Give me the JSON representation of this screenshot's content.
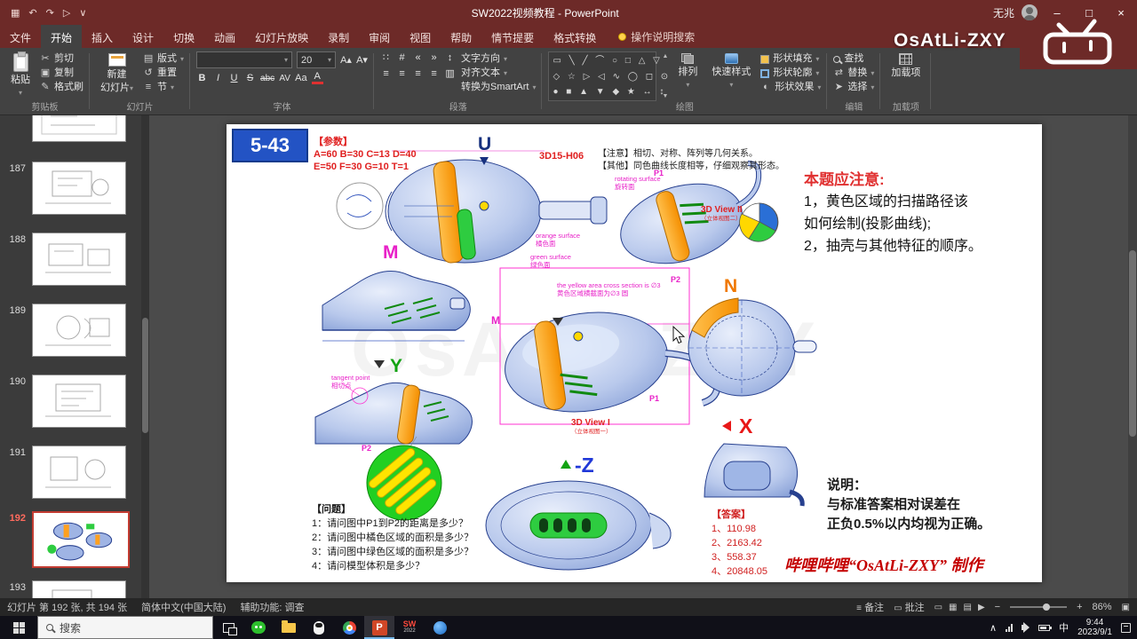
{
  "titlebar": {
    "qat": [
      "▦",
      "↶",
      "↷",
      "▷",
      "∨"
    ],
    "title": "SW2022视频教程 - PowerPoint",
    "user": "无兆",
    "win_min": "–",
    "win_max": "□",
    "win_close": "×"
  },
  "watermark": {
    "name": "OsAtLi-ZXY"
  },
  "ribbon": {
    "caret": "▾",
    "tabs": [
      {
        "label": "文件"
      },
      {
        "label": "开始"
      },
      {
        "label": "插入"
      },
      {
        "label": "设计"
      },
      {
        "label": "切换"
      },
      {
        "label": "动画"
      },
      {
        "label": "幻灯片放映"
      },
      {
        "label": "录制"
      },
      {
        "label": "审阅"
      },
      {
        "label": "视图"
      },
      {
        "label": "帮助"
      },
      {
        "label": "情节提要"
      },
      {
        "label": "格式转换"
      }
    ],
    "tell_me": "操作说明搜索",
    "clipboard": {
      "paste": "粘贴",
      "cut": "剪切",
      "copy": "复制",
      "painter": "格式刷",
      "group": "剪贴板",
      "icons": {
        "cut": "✂",
        "copy": "▣",
        "painter": "✎"
      }
    },
    "slides_group": {
      "new_slide_top": "新建",
      "new_slide_bottom": "幻灯片",
      "layout": "版式",
      "reset": "重置",
      "section": "节",
      "group": "幻灯片",
      "icons": {
        "layout": "▤",
        "reset": "↺",
        "section": "≡"
      }
    },
    "font": {
      "size": "20",
      "bold": "B",
      "italic": "I",
      "underline": "U",
      "strike": "S",
      "abc": "abc",
      "av": "AV",
      "aa": "Aa",
      "color_a": "A",
      "grow": "A▴",
      "shrink": "A▾",
      "group": "字体"
    },
    "paragraph": {
      "bullets": "∷",
      "numbering": "#",
      "outdent": "«",
      "indent": "»",
      "spacing": "↕",
      "align": "≡",
      "columns": "▥",
      "text_direction": "文字方向",
      "align_text": "对齐文本",
      "smartart": "转换为SmartArt",
      "group": "段落"
    },
    "drawing": {
      "shapes_rows": [
        "▭ ╲ ╱ ⌒ ○ □ △ ▽",
        "◇ ☆ ▷ ◁ ∿ ◯ ◻ ⊙",
        "● ■ ▲ ▼ ◆ ★ ↔ ↕"
      ],
      "gallery_up": "▲",
      "gallery_down": "▼",
      "arrange": "排列",
      "quick_styles": "快速样式",
      "fill": "形状填充",
      "outline": "形状轮廓",
      "effects": "形状效果",
      "effects_icon": "◐",
      "group": "绘图"
    },
    "editing": {
      "find": "查找",
      "replace": "替换",
      "select": "选择",
      "replace_icon": "⇄",
      "select_icon": "➤",
      "group": "编辑"
    },
    "addins": {
      "label": "加载项",
      "icon": "▦",
      "group": "加载项"
    }
  },
  "sidebar": {
    "slides": [
      {
        "number": "187"
      },
      {
        "number": "188"
      },
      {
        "number": "189"
      },
      {
        "number": "190"
      },
      {
        "number": "191"
      },
      {
        "number": "192"
      },
      {
        "number": "193"
      }
    ]
  },
  "slide": {
    "badge": "5-43",
    "params_title": "【参数】",
    "params_line1": "A=60  B=30  C=13 D=40",
    "params_line2": "E=50  F=30  G=10 T=1",
    "code": "3D15-H06",
    "note1": "【注意】相切、对称、阵列等几何关系。",
    "note2": "【其他】同色曲线长度相等，仔细观察其形态。",
    "labels": {
      "u": "U",
      "m": "M",
      "y": "Y",
      "n": "N",
      "x": "X",
      "neg_z": "-Z",
      "p1": "P1",
      "p2": "P2"
    },
    "captions": {
      "view2": "3D View II",
      "view2_sub": "（立体视图二）",
      "view1": "3D View I",
      "view1_sub": "（立体视图一）"
    },
    "annotations": {
      "rotating1": "rotating surface",
      "rotating2": "旋转面",
      "orange1": "orange surface",
      "orange2": "橘色面",
      "green1": "green surface",
      "green2": "绿色面",
      "yellow1": "the yellow area cross section is ∅3",
      "yellow2": "黄色区域横截面为∅3 圆",
      "tangent1": "tangent point",
      "tangent2": "相切点"
    },
    "right_note": {
      "title": "本题应注意:",
      "line1": "1，黄色区域的扫描路径该",
      "line2": "如何绘制(投影曲线);",
      "line3": "2，抽壳与其他特征的顺序。"
    },
    "questions": {
      "title": "【问题】",
      "q1": "1：请问图中P1到P2的距离是多少？",
      "q2": "2：请问图中橘色区域的面积是多少？",
      "q3": "3：请问图中绿色区域的面积是多少？",
      "q4": "4：请问模型体积是多少？"
    },
    "answers": {
      "title": "【答案】",
      "a1": "1、110.98",
      "a2": "2、2163.42",
      "a3": "3、558.37",
      "a4": "4、20848.05"
    },
    "explain": {
      "title": "说明：",
      "line1": "与标准答案相对误差在",
      "line2": "正负0.5%以内均视为正确。"
    },
    "credit": "哔哩哔哩“OsAtLi-ZXY” 制作",
    "ghost": "OsAtLi-ZXY"
  },
  "statusbar": {
    "slide_info": "幻灯片 第 192 张, 共 194 张",
    "language": "简体中文(中国大陆)",
    "accessibility": "辅助功能: 调查",
    "notes_icon": "≡",
    "notes": "备注",
    "comments_icon": "▭",
    "comments": "批注",
    "views": [
      "▭",
      "▦",
      "▤",
      "▶"
    ],
    "zoom_out": "−",
    "zoom_in": "+",
    "zoom": "86%",
    "fit_icon": "▣"
  },
  "taskbar": {
    "search": "搜索",
    "ppt_letter": "P",
    "sw_label": "SW",
    "sw_year": "2022",
    "tray_chevron": "∧",
    "ime": "中",
    "time": "9:44",
    "date": "2023/9/1"
  }
}
